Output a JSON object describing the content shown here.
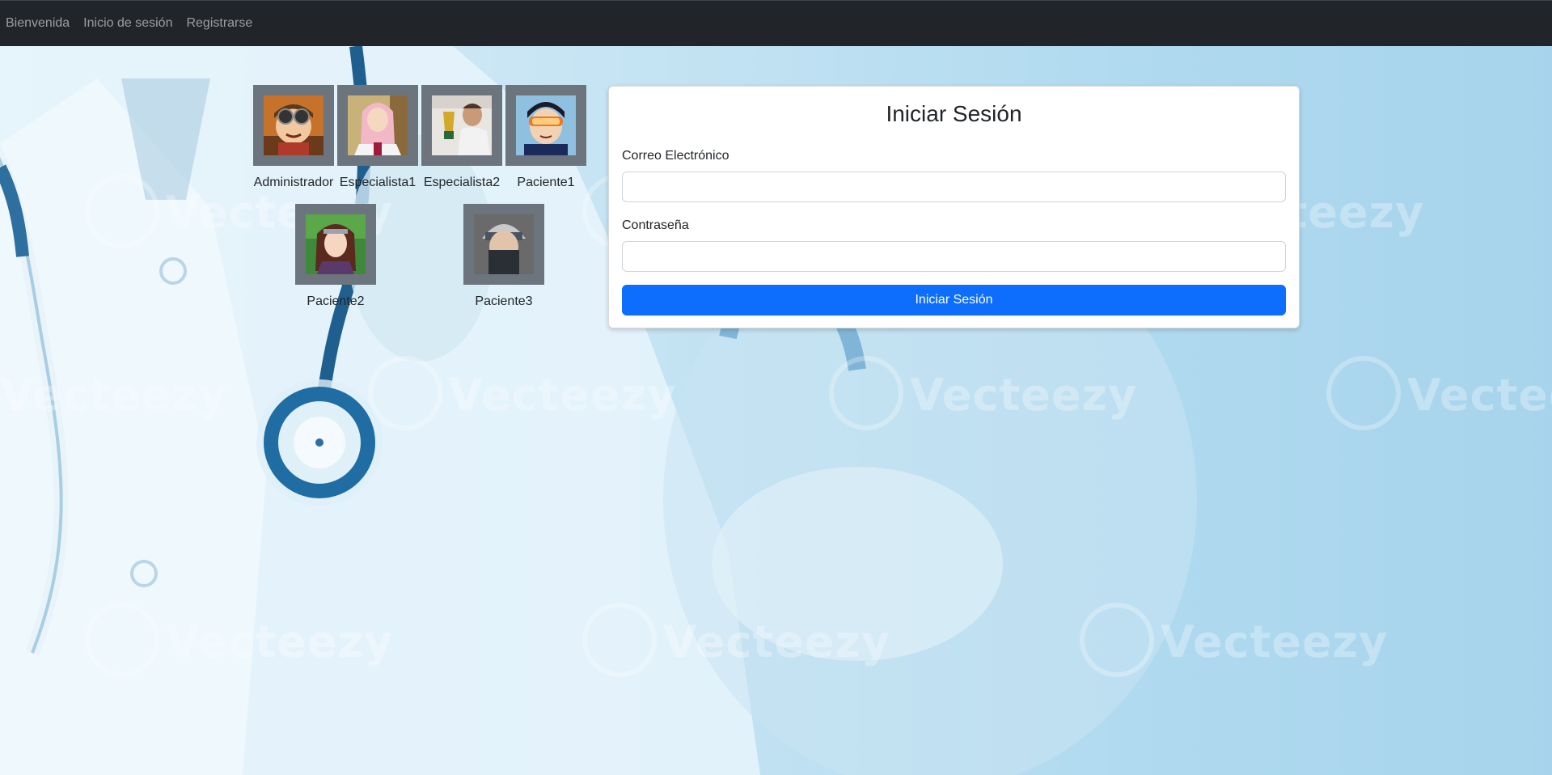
{
  "navbar": {
    "links": [
      "Bienvenida",
      "Inicio de sesión",
      "Registrarse"
    ]
  },
  "background": {
    "watermark_text": "Vecteezy"
  },
  "quick_users": [
    {
      "label": "Administrador",
      "avatar": "boy-with-goggles"
    },
    {
      "label": "Especialista1",
      "avatar": "pink-haired-doctor"
    },
    {
      "label": "Especialista2",
      "avatar": "man-with-trophy"
    },
    {
      "label": "Paciente1",
      "avatar": "boy-with-orange-goggles"
    },
    {
      "label": "Paciente2",
      "avatar": "brown-haired-girl-headband"
    },
    {
      "label": "Paciente3",
      "avatar": "masked-ninja"
    }
  ],
  "login": {
    "title": "Iniciar Sesión",
    "email_label": "Correo Electrónico",
    "email_value": "",
    "password_label": "Contraseña",
    "password_value": "",
    "submit_label": "Iniciar Sesión"
  },
  "colors": {
    "navbar": "#212529",
    "primary": "#0d6efd",
    "avatar_frame": "#6c757d"
  }
}
